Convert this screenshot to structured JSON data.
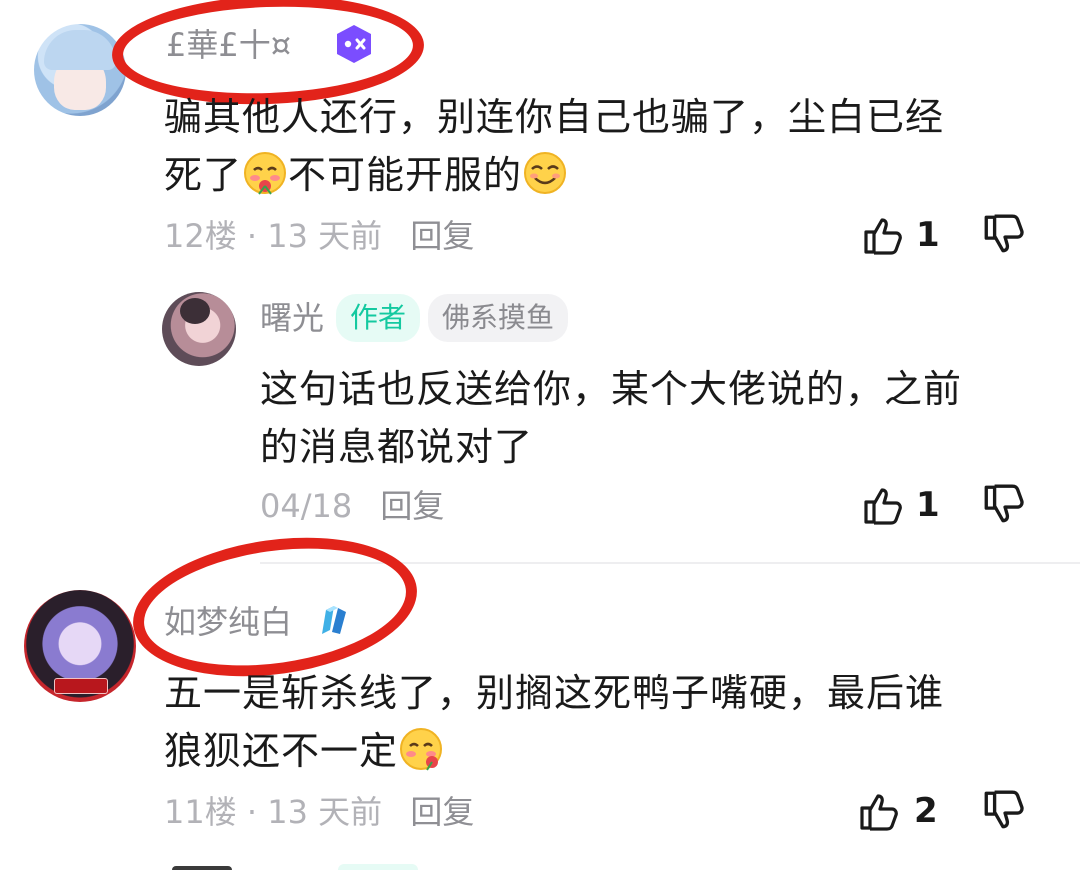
{
  "comments": [
    {
      "username": "£華£十¤",
      "content_line1": "骗其他人还行，别连你自己也骗了，尘白已经",
      "content_line2a": "死了",
      "content_line2b": "不可能开服的",
      "floor": "12楼",
      "time": "13 天前",
      "reply_label": "回复",
      "likes": "1",
      "reply": {
        "username": "曙光",
        "author_badge": "作者",
        "tag": "佛系摸鱼",
        "content_line1": "这句话也反送给你，某个大佬说的，之前",
        "content_line2": "的消息都说对了",
        "date": "04/18",
        "reply_label": "回复",
        "likes": "1"
      }
    },
    {
      "username": "如梦纯白",
      "content_line1": "五一是斩杀线了，别搁这死鸭子嘴硬，最后谁",
      "content_line2a": "狼狈还不一定",
      "floor": "11楼",
      "time": "13 天前",
      "reply_label": "回复",
      "likes": "2"
    }
  ],
  "dot_separator": "·",
  "icons": {
    "like": "thumbs-up-outline-icon",
    "dislike": "thumbs-down-outline-icon",
    "level_badge": "game-controller-badge-icon",
    "title_badge": "crystal-badge-icon"
  },
  "colors": {
    "author_badge_bg": "#e6fbf5",
    "author_badge_text": "#14c9a0",
    "tag_bg": "#f2f2f4",
    "tag_text": "#8a8a8f",
    "annotation_red": "#e2231a",
    "level_badge": "#7b4dff"
  }
}
